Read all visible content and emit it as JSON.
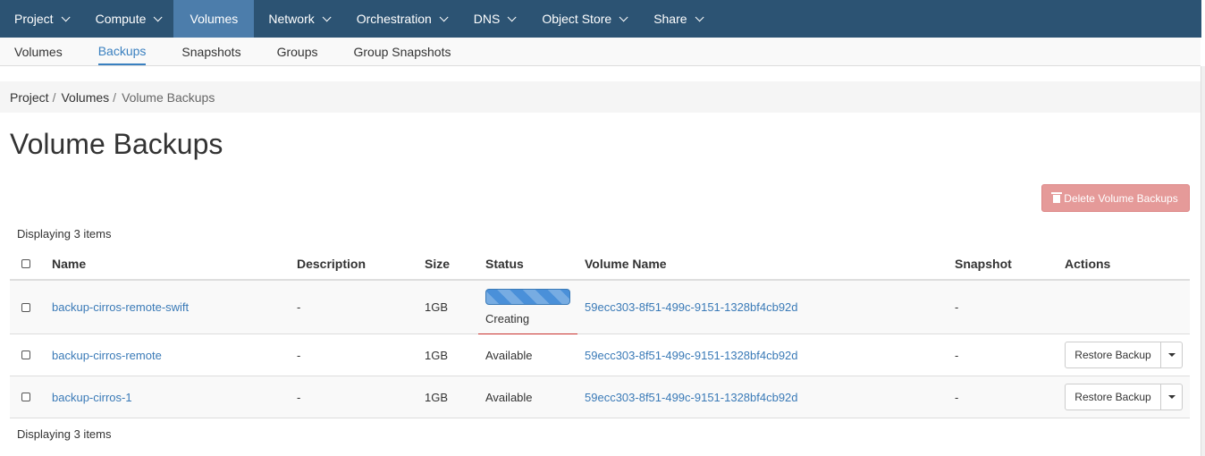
{
  "topnav": {
    "items": [
      {
        "label": "Project"
      },
      {
        "label": "Compute"
      },
      {
        "label": "Volumes"
      },
      {
        "label": "Network"
      },
      {
        "label": "Orchestration"
      },
      {
        "label": "DNS"
      },
      {
        "label": "Object Store"
      },
      {
        "label": "Share"
      }
    ],
    "active": "Volumes"
  },
  "subnav": {
    "items": [
      {
        "label": "Volumes"
      },
      {
        "label": "Backups"
      },
      {
        "label": "Snapshots"
      },
      {
        "label": "Groups"
      },
      {
        "label": "Group Snapshots"
      }
    ],
    "active": "Backups"
  },
  "breadcrumb": {
    "items": [
      {
        "label": "Project"
      },
      {
        "label": "Volumes"
      },
      {
        "label": "Volume Backups"
      }
    ],
    "separator": "/"
  },
  "page": {
    "title": "Volume Backups",
    "delete_button": "Delete Volume Backups",
    "count_top": "Displaying 3 items",
    "count_bottom": "Displaying 3 items"
  },
  "table": {
    "headers": {
      "name": "Name",
      "description": "Description",
      "size": "Size",
      "status": "Status",
      "volume_name": "Volume Name",
      "snapshot": "Snapshot",
      "actions": "Actions"
    },
    "rows": [
      {
        "name": "backup-cirros-remote-swift",
        "description": "-",
        "size": "1GB",
        "status": "Creating",
        "volume_name": "59ecc303-8f51-499c-9151-1328bf4cb92d",
        "snapshot": "-",
        "action": ""
      },
      {
        "name": "backup-cirros-remote",
        "description": "-",
        "size": "1GB",
        "status": "Available",
        "volume_name": "59ecc303-8f51-499c-9151-1328bf4cb92d",
        "snapshot": "-",
        "action": "Restore Backup"
      },
      {
        "name": "backup-cirros-1",
        "description": "-",
        "size": "1GB",
        "status": "Available",
        "volume_name": "59ecc303-8f51-499c-9151-1328bf4cb92d",
        "snapshot": "-",
        "action": "Restore Backup"
      }
    ]
  },
  "colors": {
    "topnav_bg": "#2c5373",
    "topnav_active": "#4c7dab",
    "link": "#3a7ab7",
    "danger_disabled": "#e59a99",
    "progress": "#4a90d9"
  }
}
